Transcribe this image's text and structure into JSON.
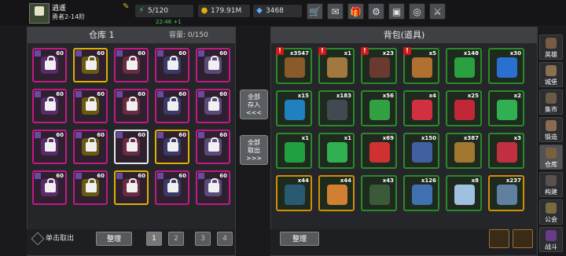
{
  "player": {
    "name": "逍遥",
    "level": "勇者2-14阶"
  },
  "stats": {
    "stamina": "5/120",
    "stamina_regen": "22:46 +1",
    "gold": "179.91M",
    "gems": "3468"
  },
  "toolbar_icons": [
    "shop-icon",
    "mail-icon",
    "gift-icon",
    "settings-icon",
    "chest-icon",
    "rainbow-icon",
    "sword-icon"
  ],
  "warehouse": {
    "title": "仓库 1",
    "capacity": "容量: 0/150",
    "take_out_label": "单击取出",
    "sort_label": "整理",
    "pages": [
      "1",
      "2",
      "3",
      "4"
    ],
    "slots": [
      {
        "count": "60",
        "color": "#c01a86"
      },
      {
        "count": "60",
        "color": "#e0b000"
      },
      {
        "count": "60",
        "color": "#c01a86"
      },
      {
        "count": "60",
        "color": "#c01a86"
      },
      {
        "count": "60",
        "color": "#c01a86"
      },
      {
        "count": "60",
        "color": "#c01a86"
      },
      {
        "count": "60",
        "color": "#c01a86"
      },
      {
        "count": "60",
        "color": "#c01a86"
      },
      {
        "count": "60",
        "color": "#c01a86"
      },
      {
        "count": "60",
        "color": "#c01a86"
      },
      {
        "count": "60",
        "color": "#c01a86"
      },
      {
        "count": "60",
        "color": "#c01a86"
      },
      {
        "count": "60",
        "color": "#e8e8e8"
      },
      {
        "count": "60",
        "color": "#e0b000"
      },
      {
        "count": "60",
        "color": "#c01a86"
      },
      {
        "count": "60",
        "color": "#c01a86"
      },
      {
        "count": "60",
        "color": "#c01a86"
      },
      {
        "count": "60",
        "color": "#e0b000"
      },
      {
        "count": "60",
        "color": "#c01a86"
      },
      {
        "count": "60",
        "color": "#c01a86"
      }
    ]
  },
  "transfer": {
    "store_all": "全部 存入 <<<",
    "take_all": "全部 取出 >>>"
  },
  "backpack": {
    "title": "背包(道具)",
    "sort_label": "整理",
    "slots": [
      {
        "count": "x3547",
        "color": "#2a8a2a"
      },
      {
        "count": "x1",
        "color": "#2a8a2a"
      },
      {
        "count": "x23",
        "color": "#2a8a2a"
      },
      {
        "count": "x5",
        "color": "#2a8a2a"
      },
      {
        "count": "x148",
        "color": "#2a8a2a"
      },
      {
        "count": "x30",
        "color": "#2a8a2a"
      },
      {
        "count": "x15",
        "color": "#2a8a2a"
      },
      {
        "count": "x183",
        "color": "#2a8a2a"
      },
      {
        "count": "x56",
        "color": "#2a8a2a"
      },
      {
        "count": "x4",
        "color": "#2a8a2a"
      },
      {
        "count": "x25",
        "color": "#2a8a2a"
      },
      {
        "count": "x2",
        "color": "#2a8a2a"
      },
      {
        "count": "x1",
        "color": "#2a8a2a"
      },
      {
        "count": "x1",
        "color": "#2a8a2a"
      },
      {
        "count": "x69",
        "color": "#2a8a2a"
      },
      {
        "count": "x150",
        "color": "#2a8a2a"
      },
      {
        "count": "x387",
        "color": "#2a8a2a"
      },
      {
        "count": "x3",
        "color": "#2a8a2a"
      },
      {
        "count": "x44",
        "color": "#d09000"
      },
      {
        "count": "x44",
        "color": "#d09000"
      },
      {
        "count": "x43",
        "color": "#2a8a2a"
      },
      {
        "count": "x126",
        "color": "#2a8a2a"
      },
      {
        "count": "x8",
        "color": "#2a8a2a"
      },
      {
        "count": "x237",
        "color": "#d09000"
      }
    ]
  },
  "side_nav": [
    "英雄",
    "城堡",
    "集市",
    "锻造",
    "仓库",
    "构建",
    "公会",
    "战斗"
  ]
}
